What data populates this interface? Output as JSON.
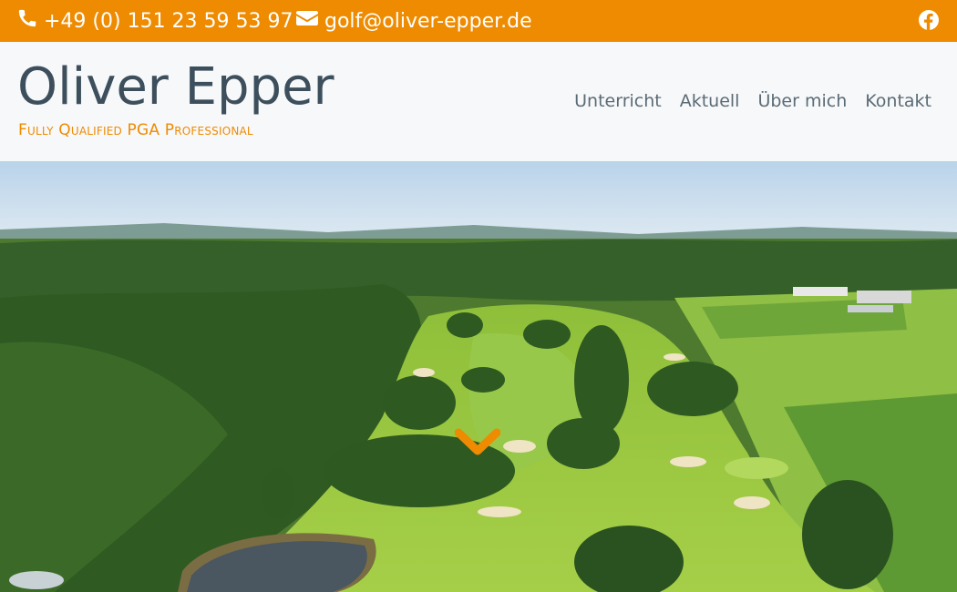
{
  "topbar": {
    "phone": "+49 (0) 151 23 59 53 97",
    "email": "golf@oliver-epper.de",
    "phone_icon": "phone-icon",
    "email_icon": "envelope-icon",
    "social_icon": "facebook-icon"
  },
  "header": {
    "title": "Oliver Epper",
    "tagline": "Fully Qualified PGA Professional"
  },
  "nav": {
    "items": [
      "Unterricht",
      "Aktuell",
      "Über mich",
      "Kontakt"
    ]
  },
  "hero": {
    "image_alt": "Aerial view of golf course with forests and fields",
    "scroll_icon": "chevron-down-icon"
  },
  "colors": {
    "accent": "#ee8b00",
    "title": "#3d4f5c",
    "nav": "#5b6b76",
    "header_bg": "#f7f8fa"
  }
}
